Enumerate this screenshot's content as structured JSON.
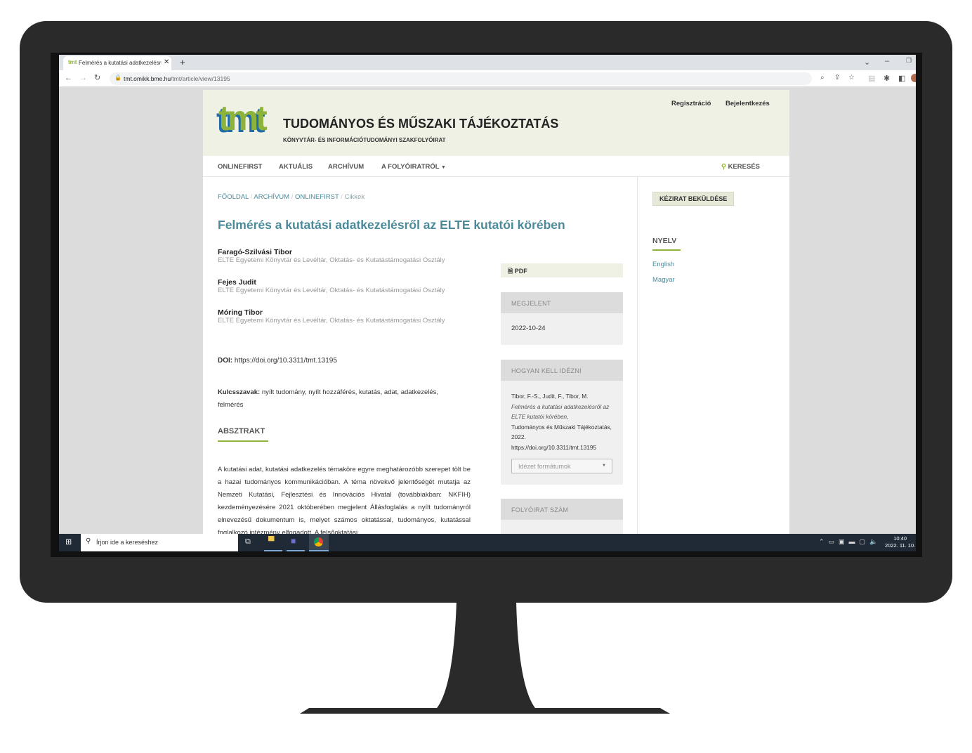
{
  "browser": {
    "tab_title": "Felmérés a kutatási adatkezelésről",
    "url_host": "tmt.omikk.bme.hu",
    "url_path": "/tmt/article/view/13195"
  },
  "header": {
    "logo_text": "tmt",
    "title": "TUDOMÁNYOS ÉS MŰSZAKI TÁJÉKOZTATÁS",
    "subtitle": "KÖNYVTÁR- ÉS INFORMÁCIÓTUDOMÁNYI SZAKFOLYÓIRAT",
    "register": "Regisztráció",
    "login": "Bejelentkezés"
  },
  "nav": {
    "items": [
      "ONLINEFIRST",
      "AKTUÁLIS",
      "ARCHÍVUM",
      "A FOLYÓIRATRÓL"
    ],
    "search": "KERESÉS"
  },
  "breadcrumb": [
    "FŐOLDAL",
    "ARCHÍVUM",
    "ONLINEFIRST",
    "Cikkek"
  ],
  "article": {
    "title": "Felmérés a kutatási adatkezelésről az ELTE kutatói körében",
    "authors": [
      {
        "name": "Faragó-Szilvási Tibor",
        "affiliation": "ELTE Egyetemi Könyvtár és Levéltár, Oktatás- és Kutatástámogatási Osztály"
      },
      {
        "name": "Fejes Judit",
        "affiliation": "ELTE Egyetemi Könyvtár és Levéltár, Oktatás- és Kutatástámogatási Osztály"
      },
      {
        "name": "Móring Tibor",
        "affiliation": "ELTE Egyetemi Könyvtár és Levéltár, Oktatás- és Kutatástámogatási Osztály"
      }
    ],
    "doi_label": "DOI:",
    "doi": "https://doi.org/10.3311/tmt.13195",
    "keywords_label": "Kulcsszavak:",
    "keywords": "nyílt tudomány, nyílt hozzáférés, kutatás, adat, adatkezelés, felmérés",
    "abstract_heading": "ABSZTRAKT",
    "abstract": "A kutatási adat, kutatási adatkezelés témaköre egyre meghatározóbb szerepet tölt be a hazai tudományos kommunikációban. A téma növekvő jelentőségét mutatja az Nemzeti Kutatási, Fejlesztési és Innovációs Hivatal (továbbiakban: NKFIH) kezdeményezésére 2021 októberében megjelent Állásfoglalás a nyílt tudományról elnevezésű dokumentum is, melyet számos oktatással, tudományos, kutatással foglalkozó intézmény elfogadott. A felsőoktatási"
  },
  "details": {
    "pdf": "PDF",
    "published_label": "MEGJELENT",
    "published": "2022-10-24",
    "cite_label": "HOGYAN KELL IDÉZNI",
    "cite_authors": "Tibor, F.-S., Judit, F., Tibor, M.",
    "cite_title": "Felmérés a kutatási adatkezelésről az ELTE kutatói körében",
    "cite_journal": "Tudományos és Műszaki Tájékoztatás, 2022.",
    "cite_doi": "https://doi.org/10.3311/tmt.13195",
    "cite_formats": "Idézet formátumok",
    "issue_label": "FOLYÓIRAT SZÁM"
  },
  "sidebar": {
    "submit": "KÉZIRAT BEKÜLDÉSE",
    "language_heading": "NYELV",
    "languages": [
      "English",
      "Magyar"
    ]
  },
  "taskbar": {
    "search_placeholder": "Írjon ide a kereséshez",
    "time": "10:40",
    "date": "2022. 11. 10."
  },
  "colors": {
    "accent": "#4a8a9a",
    "green": "#8db33a",
    "header_bg": "#eff1e5"
  }
}
